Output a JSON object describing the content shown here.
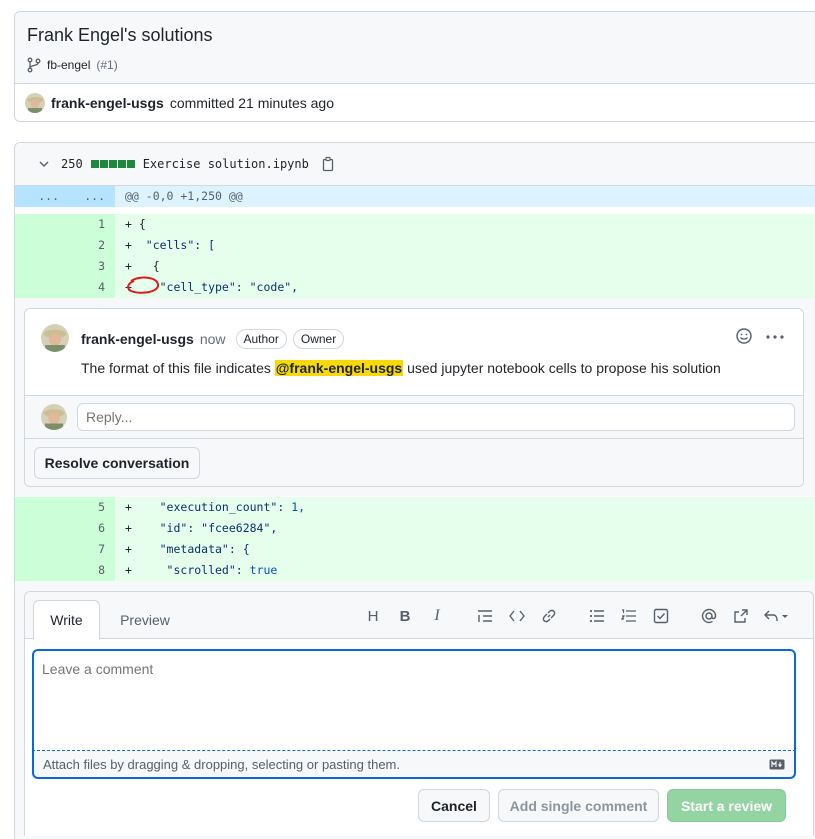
{
  "commit": {
    "title": "Frank Engel's solutions",
    "branch": "fb-engel",
    "pr_number": "(#1)",
    "author": "frank-engel-usgs",
    "committed_text": "committed 21 minutes ago"
  },
  "file": {
    "changes": "250",
    "name": "Exercise solution.ipynb",
    "hunk_left": "...",
    "hunk_right": "...",
    "hunk_header": "@@ -0,0 +1,250 @@"
  },
  "diff_lines_a": [
    {
      "ln": "1",
      "prefix": "+ ",
      "text": "{"
    },
    {
      "ln": "2",
      "prefix": "+  ",
      "text": "\"cells\": ["
    },
    {
      "ln": "3",
      "prefix": "+   ",
      "text": "{"
    },
    {
      "ln": "4",
      "prefix": "+    ",
      "text": "\"cell_type\": \"code\","
    }
  ],
  "diff_lines_b": [
    {
      "ln": "5",
      "prefix": "+    ",
      "text": "\"execution_count\": ",
      "kw": "1,"
    },
    {
      "ln": "6",
      "prefix": "+    ",
      "text": "\"id\": \"fcee6284\","
    },
    {
      "ln": "7",
      "prefix": "+    ",
      "text": "\"metadata\": {"
    },
    {
      "ln": "8",
      "prefix": "+     ",
      "text": "\"scrolled\": ",
      "kw": "true"
    }
  ],
  "thread": {
    "author": "frank-engel-usgs",
    "time": "now",
    "badge_author": "Author",
    "badge_owner": "Owner",
    "body_before": "The format of this file indicates",
    "mention": "@frank-engel-usgs",
    "body_after": "used jupyter notebook cells to propose his solution",
    "reply_placeholder": "Reply...",
    "resolve_label": "Resolve conversation"
  },
  "composer": {
    "tab_write": "Write",
    "tab_preview": "Preview",
    "placeholder": "Leave a comment",
    "attach_hint": "Attach files by dragging & dropping, selecting or pasting them.",
    "cancel_label": "Cancel",
    "single_label": "Add single comment",
    "review_label": "Start a review"
  },
  "colors": {
    "accent_green": "#1f883d",
    "add_bg": "#e6ffec",
    "add_num_bg": "#ccffd8",
    "hunk_bg": "#ddf4ff",
    "mention_bg": "#f5d90a",
    "annotation_red": "#e01b1b"
  }
}
